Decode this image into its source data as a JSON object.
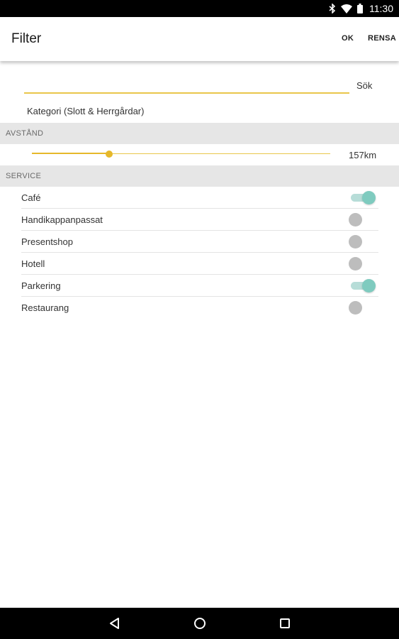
{
  "status_bar": {
    "time": "11:30",
    "icons": [
      "bluetooth-icon",
      "wifi-icon",
      "battery-icon"
    ]
  },
  "app_bar": {
    "title": "Filter",
    "ok_label": "OK",
    "clear_label": "RENSA"
  },
  "search": {
    "label": "Sök",
    "category": "Kategori (Slott & Herrgårdar)"
  },
  "distance": {
    "header": "AVSTÅND",
    "value_label": "157km",
    "fraction": 0.26
  },
  "service": {
    "header": "SERVICE",
    "items": [
      {
        "label": "Café",
        "enabled": true
      },
      {
        "label": "Handikappanpassat",
        "enabled": false
      },
      {
        "label": "Presentshop",
        "enabled": false
      },
      {
        "label": "Hotell",
        "enabled": false
      },
      {
        "label": "Parkering",
        "enabled": true
      },
      {
        "label": "Restaurang",
        "enabled": false
      }
    ]
  },
  "colors": {
    "accent_yellow": "#e6b82a",
    "switch_on": "#7fcbbf",
    "switch_off": "#bdbdbd"
  },
  "nav_bar": {
    "icons": [
      "back-icon",
      "home-icon",
      "recents-icon"
    ]
  }
}
